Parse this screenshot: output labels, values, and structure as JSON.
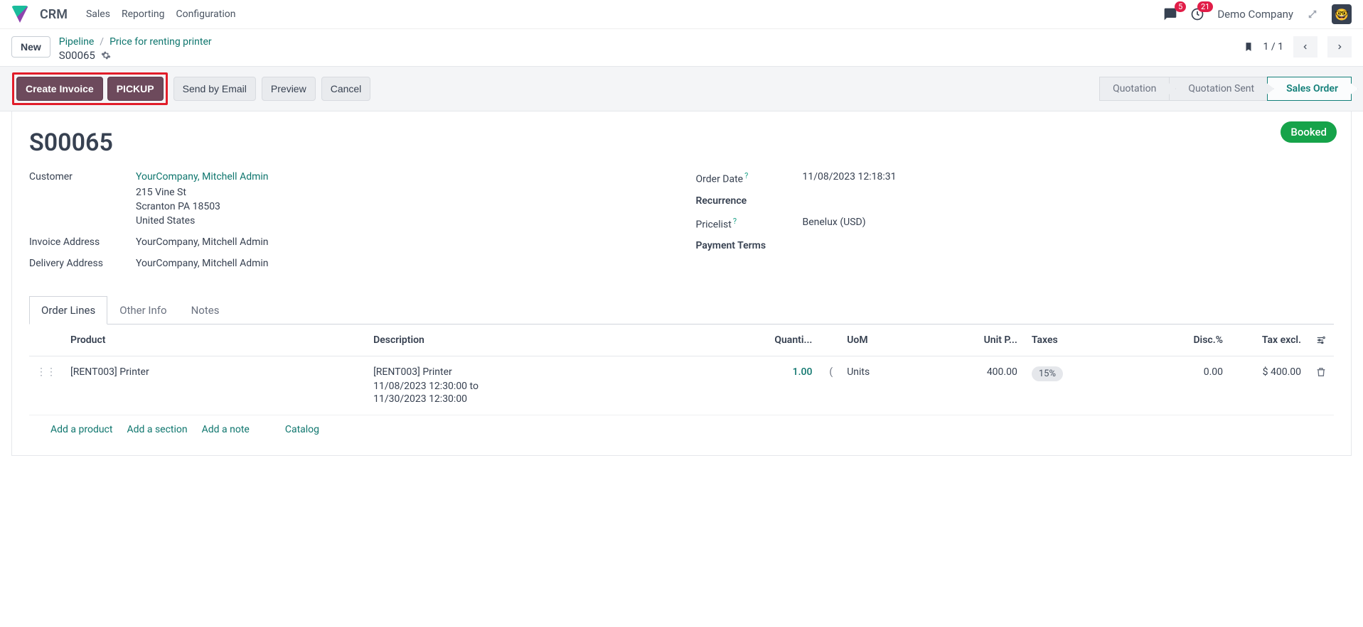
{
  "nav": {
    "app": "CRM",
    "menu": [
      "Sales",
      "Reporting",
      "Configuration"
    ],
    "msg_badge": "5",
    "bell_badge": "21",
    "company": "Demo Company"
  },
  "crumbs": {
    "new_label": "New",
    "links": [
      "Pipeline",
      "Price for renting printer"
    ],
    "record": "S00065",
    "pager": "1 / 1"
  },
  "actions": {
    "create_invoice": "Create Invoice",
    "pickup": "PICKUP",
    "send_email": "Send by Email",
    "preview": "Preview",
    "cancel": "Cancel",
    "statuses": [
      "Quotation",
      "Quotation Sent",
      "Sales Order"
    ],
    "active_status": 2
  },
  "record": {
    "title": "S00065",
    "badge": "Booked",
    "left": {
      "customer_label": "Customer",
      "customer_name": "YourCompany, Mitchell Admin",
      "addr1": "215 Vine St",
      "addr2": "Scranton PA 18503",
      "addr3": "United States",
      "invoice_addr_label": "Invoice Address",
      "invoice_addr": "YourCompany, Mitchell Admin",
      "delivery_addr_label": "Delivery Address",
      "delivery_addr": "YourCompany, Mitchell Admin"
    },
    "right": {
      "order_date_label": "Order Date",
      "order_date": "11/08/2023 12:18:31",
      "recurrence_label": "Recurrence",
      "pricelist_label": "Pricelist",
      "pricelist": "Benelux (USD)",
      "payment_terms_label": "Payment Terms"
    }
  },
  "tabs": [
    "Order Lines",
    "Other Info",
    "Notes"
  ],
  "table": {
    "headers": {
      "product": "Product",
      "description": "Description",
      "qty": "Quanti...",
      "uom": "UoM",
      "unit_price": "Unit P...",
      "taxes": "Taxes",
      "disc": "Disc.%",
      "tax_excl": "Tax excl."
    },
    "rows": [
      {
        "product": "[RENT003] Printer",
        "desc_l1": "[RENT003] Printer",
        "desc_l2": "11/08/2023 12:30:00 to",
        "desc_l3": "11/30/2023 12:30:00",
        "qty": "1.00",
        "qty_extra": "(",
        "uom": "Units",
        "unit_price": "400.00",
        "tax": "15%",
        "disc": "0.00",
        "tax_excl": "$ 400.00"
      }
    ],
    "add": {
      "product": "Add a product",
      "section": "Add a section",
      "note": "Add a note",
      "catalog": "Catalog"
    }
  }
}
